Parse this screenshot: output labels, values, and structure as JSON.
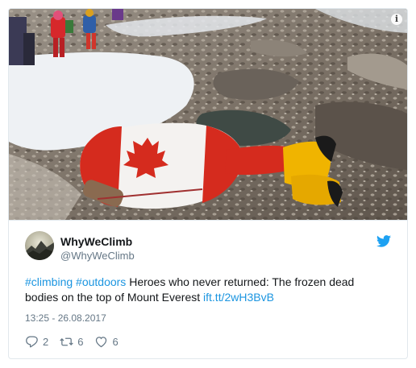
{
  "media": {
    "description_icon": "i"
  },
  "author": {
    "name": "WhyWeClimb",
    "handle": "@WhyWeClimb"
  },
  "tweet": {
    "hashtag1": "#climbing",
    "hashtag2": "#outdoors",
    "text": "Heroes who never returned: The frozen dead bodies on the top of Mount Everest",
    "link": "ift.tt/2wH3BvB",
    "timestamp": "13:25 - 26.08.2017"
  },
  "actions": {
    "replies": "2",
    "retweets": "6",
    "likes": "6"
  },
  "icons": {
    "brand": "twitter-bird-icon",
    "reply": "reply-icon",
    "retweet": "retweet-icon",
    "like": "heart-icon",
    "info": "info-icon"
  },
  "colors": {
    "link": "#1b95e0",
    "brand": "#1da1f2",
    "muted": "#657786",
    "flag_red": "#d52b1e"
  }
}
